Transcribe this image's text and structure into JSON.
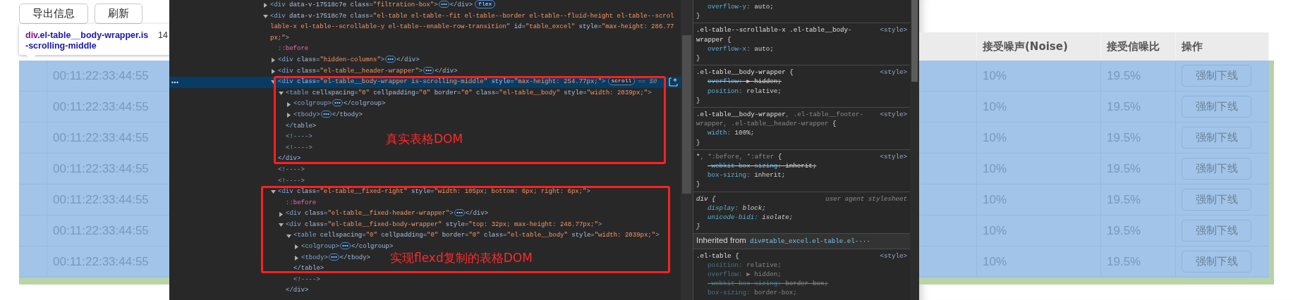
{
  "page": {
    "buttons": [
      "导出信息",
      "刷新"
    ],
    "tooltip": {
      "tag": "div",
      "classes": ".el-table__body-wrapper.is-scrolling-middle",
      "size": "14"
    },
    "left_table": {
      "rows": [
        "00:11:22:33:44:55",
        "00:11:22:33:44:55",
        "00:11:22:33:44:55",
        "00:11:22:33:44:55",
        "00:11:22:33:44:55",
        "00:11:22:33:44:55",
        "00:11:22:33:44:55"
      ]
    },
    "right_table": {
      "columns": [
        "接受噪声(Noise)",
        "接受信噪比",
        "操作"
      ],
      "rows": [
        {
          "noise": "10%",
          "snr": "19.5%",
          "action": "强制下线"
        },
        {
          "noise": "10%",
          "snr": "19.5%",
          "action": "强制下线"
        },
        {
          "noise": "10%",
          "snr": "19.5%",
          "action": "强制下线"
        },
        {
          "noise": "10%",
          "snr": "19.5%",
          "action": "强制下线"
        },
        {
          "noise": "10%",
          "snr": "19.5%",
          "action": "强制下线"
        },
        {
          "noise": "10%",
          "snr": "19.5%",
          "action": "强制下线"
        },
        {
          "noise": "10%",
          "snr": "19.5%",
          "action": "强制下线"
        }
      ]
    }
  },
  "elements_panel": {
    "nodes": [
      {
        "kind": "element",
        "selected": false,
        "expanded": false,
        "parts": [
          {
            "kind": "tag",
            "text": "<div "
          },
          {
            "kind": "attr",
            "text": "data-v-17518c7e class="
          },
          {
            "kind": "value",
            "text": "\"filtration-box\""
          },
          {
            "kind": "tag",
            "text": ">"
          }
        ],
        "closing": "</div>",
        "badge": "flex"
      },
      {
        "kind": "element",
        "selected": false,
        "expanded": true,
        "parts": [
          {
            "kind": "tag",
            "text": "<div "
          },
          {
            "kind": "attr",
            "text": "data-v-17518c7e class="
          },
          {
            "kind": "value",
            "text": "\"el-table el-table--fit el-table--border el-table--fluid-height el-table--scrollable-x el-table--scrollable-y el-table--enable-row-transition\""
          },
          {
            "kind": "attr",
            "text": " id="
          },
          {
            "kind": "value",
            "text": "\"table_excel\""
          },
          {
            "kind": "attr",
            "text": " style="
          },
          {
            "kind": "value",
            "text": "\"max-height: 286.77px;\""
          },
          {
            "kind": "tag",
            "text": ">"
          }
        ],
        "children": [
          {
            "kind": "pseudo",
            "selected": false,
            "text": "::before"
          },
          {
            "kind": "element",
            "selected": false,
            "expanded": false,
            "parts": [
              {
                "kind": "tag",
                "text": "<div "
              },
              {
                "kind": "attr",
                "text": "class="
              },
              {
                "kind": "value",
                "text": "\"hidden-columns\""
              },
              {
                "kind": "tag",
                "text": ">"
              }
            ],
            "closing": "</div>"
          },
          {
            "kind": "element",
            "selected": false,
            "expanded": false,
            "parts": [
              {
                "kind": "tag",
                "text": "<div "
              },
              {
                "kind": "attr",
                "text": "class="
              },
              {
                "kind": "value",
                "text": "\"el-table__header-wrapper\""
              },
              {
                "kind": "tag",
                "text": ">"
              }
            ],
            "closing": "</div>"
          },
          {
            "kind": "element",
            "selected": true,
            "expanded": true,
            "parts": [
              {
                "kind": "tag",
                "text": "<div "
              },
              {
                "kind": "attr",
                "text": "class="
              },
              {
                "kind": "value",
                "text": "\"el-table__body-wrapper is-scrolling-middle\""
              },
              {
                "kind": "attr",
                "text": " style="
              },
              {
                "kind": "value",
                "text": "\"max-height: 254.77px;\""
              },
              {
                "kind": "tag",
                "text": ">"
              }
            ],
            "badge": "scroll",
            "console": "== $0",
            "closing": "</div>",
            "children": [
              {
                "kind": "element",
                "selected": false,
                "expanded": true,
                "parts": [
                  {
                    "kind": "tag",
                    "text": "<table "
                  },
                  {
                    "kind": "attr",
                    "text": "cellspacing="
                  },
                  {
                    "kind": "value",
                    "text": "\"0\""
                  },
                  {
                    "kind": "attr",
                    "text": " cellpadding="
                  },
                  {
                    "kind": "value",
                    "text": "\"0\""
                  },
                  {
                    "kind": "attr",
                    "text": " border="
                  },
                  {
                    "kind": "value",
                    "text": "\"0\""
                  },
                  {
                    "kind": "attr",
                    "text": " class="
                  },
                  {
                    "kind": "value",
                    "text": "\"el-table__body\""
                  },
                  {
                    "kind": "attr",
                    "text": " style="
                  },
                  {
                    "kind": "value",
                    "text": "\"width: 2039px;\""
                  },
                  {
                    "kind": "tag",
                    "text": ">"
                  }
                ],
                "closing": "</table>",
                "children": [
                  {
                    "kind": "element",
                    "selected": false,
                    "expanded": false,
                    "parts": [
                      {
                        "kind": "tag",
                        "text": "<colgroup>"
                      }
                    ],
                    "closing": "</colgroup>"
                  },
                  {
                    "kind": "element",
                    "selected": false,
                    "expanded": false,
                    "parts": [
                      {
                        "kind": "tag",
                        "text": "<tbody>"
                      }
                    ],
                    "closing": "</tbody>"
                  }
                ]
              },
              {
                "kind": "comment",
                "selected": false,
                "text": "<!---->"
              },
              {
                "kind": "comment",
                "selected": false,
                "text": "<!---->"
              }
            ]
          },
          {
            "kind": "comment",
            "selected": false,
            "text": "<!---->"
          },
          {
            "kind": "comment",
            "selected": false,
            "text": "<!---->"
          },
          {
            "kind": "element",
            "selected": false,
            "expanded": true,
            "parts": [
              {
                "kind": "tag",
                "text": "<div "
              },
              {
                "kind": "attr",
                "text": "class="
              },
              {
                "kind": "value",
                "text": "\"el-table__fixed-right\""
              },
              {
                "kind": "attr",
                "text": " style="
              },
              {
                "kind": "value",
                "text": "\"width: 105px; bottom: 6px; right: 6px;\""
              },
              {
                "kind": "tag",
                "text": ">"
              }
            ],
            "children": [
              {
                "kind": "pseudo",
                "selected": false,
                "text": "::before"
              },
              {
                "kind": "element",
                "selected": false,
                "expanded": false,
                "parts": [
                  {
                    "kind": "tag",
                    "text": "<div "
                  },
                  {
                    "kind": "attr",
                    "text": "class="
                  },
                  {
                    "kind": "value",
                    "text": "\"el-table__fixed-header-wrapper\""
                  },
                  {
                    "kind": "tag",
                    "text": ">"
                  }
                ],
                "closing": "</div>"
              },
              {
                "kind": "element",
                "selected": false,
                "expanded": true,
                "parts": [
                  {
                    "kind": "tag",
                    "text": "<div "
                  },
                  {
                    "kind": "attr",
                    "text": "class="
                  },
                  {
                    "kind": "value",
                    "text": "\"el-table__fixed-body-wrapper\""
                  },
                  {
                    "kind": "attr",
                    "text": " style="
                  },
                  {
                    "kind": "value",
                    "text": "\"top: 32px; max-height: 248.77px;\""
                  },
                  {
                    "kind": "tag",
                    "text": ">"
                  }
                ],
                "closing": "</div>",
                "children": [
                  {
                    "kind": "element",
                    "selected": false,
                    "expanded": true,
                    "parts": [
                      {
                        "kind": "tag",
                        "text": "<table "
                      },
                      {
                        "kind": "attr",
                        "text": "cellspacing="
                      },
                      {
                        "kind": "value",
                        "text": "\"0\""
                      },
                      {
                        "kind": "attr",
                        "text": " cellpadding="
                      },
                      {
                        "kind": "value",
                        "text": "\"0\""
                      },
                      {
                        "kind": "attr",
                        "text": " border="
                      },
                      {
                        "kind": "value",
                        "text": "\"0\""
                      },
                      {
                        "kind": "attr",
                        "text": " class="
                      },
                      {
                        "kind": "value",
                        "text": "\"el-table__body\""
                      },
                      {
                        "kind": "attr",
                        "text": " style="
                      },
                      {
                        "kind": "value",
                        "text": "\"width: 2039px;\""
                      },
                      {
                        "kind": "tag",
                        "text": ">"
                      }
                    ],
                    "closing": "</table>",
                    "children": [
                      {
                        "kind": "element",
                        "selected": false,
                        "expanded": false,
                        "parts": [
                          {
                            "kind": "tag",
                            "text": "<colgroup>"
                          }
                        ],
                        "closing": "</colgroup>"
                      },
                      {
                        "kind": "element",
                        "selected": false,
                        "expanded": false,
                        "parts": [
                          {
                            "kind": "tag",
                            "text": "<tbody>"
                          }
                        ],
                        "closing": "</tbody>"
                      }
                    ]
                  },
                  {
                    "kind": "comment",
                    "selected": false,
                    "text": "<!---->"
                  }
                ]
              }
            ]
          }
        ]
      }
    ],
    "annotations": [
      {
        "label": "真实表格DOM"
      },
      {
        "label": "实现flexd复制的表格DOM"
      }
    ]
  },
  "styles_panel": {
    "rules": [
      {
        "kind": "author",
        "inherited": false,
        "declarations": [
          {
            "prop": "overflow-y:",
            "value": "auto;",
            "struck": false
          }
        ],
        "close": "}"
      },
      {
        "kind": "author",
        "inherited": false,
        "selector": [
          {
            "text": ".el-table--scrollable-x .el-table__body-wrapper {",
            "matched": true
          }
        ],
        "source": "<style>",
        "declarations": [
          {
            "prop": "overflow-x:",
            "value": "auto;",
            "struck": false
          }
        ],
        "close": "}"
      },
      {
        "kind": "author",
        "inherited": false,
        "selector": [
          {
            "text": ".el-table__body-wrapper {",
            "matched": true
          }
        ],
        "source": "<style>",
        "declarations": [
          {
            "prop": "overflow:",
            "value": "▶ hidden;",
            "struck": true
          },
          {
            "prop": "position:",
            "value": "relative;",
            "struck": false
          }
        ],
        "close": "}"
      },
      {
        "kind": "author",
        "inherited": false,
        "selector": [
          {
            "text": ".el-table__body-wrapper",
            "matched": true
          },
          {
            "text": ", .el-table__footer-wrapper, .el-table__header-wrapper",
            "matched": false
          },
          {
            "text": " {",
            "matched": true
          }
        ],
        "source": "<style>",
        "declarations": [
          {
            "prop": "width:",
            "value": "100%;",
            "struck": false
          }
        ],
        "close": "}"
      },
      {
        "kind": "author",
        "inherited": false,
        "selector": [
          {
            "text": "*",
            "matched": true
          },
          {
            "text": ", *:before, *:after",
            "matched": false
          },
          {
            "text": " {",
            "matched": true
          }
        ],
        "source": "<style>",
        "declarations": [
          {
            "prop": "-webkit-box-sizing:",
            "value": "inherit;",
            "struck": true
          },
          {
            "prop": "box-sizing:",
            "value": "inherit;",
            "struck": false
          }
        ],
        "close": "}"
      },
      {
        "kind": "ua",
        "inherited": false,
        "selector": [
          {
            "text": "div {",
            "matched": true
          }
        ],
        "source": "user agent stylesheet",
        "declarations": [
          {
            "prop": "display:",
            "value": "block;",
            "struck": false
          },
          {
            "prop": "unicode-bidi:",
            "value": "isolate;",
            "struck": false
          }
        ],
        "close": "}"
      },
      {
        "kind": "header",
        "label": "Inherited from",
        "link": "div#table_excel.el-table.el-···"
      },
      {
        "kind": "author",
        "inherited": true,
        "selector": [
          {
            "text": ".el-table {",
            "matched": true
          }
        ],
        "source": "<style>",
        "declarations": [
          {
            "prop": "position:",
            "value": "relative;",
            "struck": false
          },
          {
            "prop": "overflow:",
            "value": "▶ hidden;",
            "struck": false
          },
          {
            "prop": "-webkit-box-sizing:",
            "value": "border-box;",
            "struck": true
          },
          {
            "prop": "box-sizing:",
            "value": "border-box;",
            "struck": false
          }
        ]
      }
    ]
  }
}
